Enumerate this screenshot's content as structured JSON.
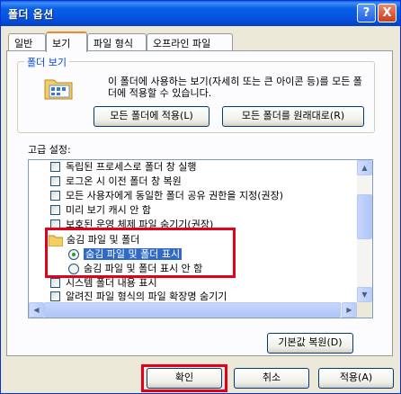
{
  "window": {
    "title": "폴더 옵션",
    "help_label": "?",
    "close_label": "X"
  },
  "tabs": [
    {
      "label": "일반",
      "active": false
    },
    {
      "label": "보기",
      "active": true
    },
    {
      "label": "파일 형식",
      "active": false
    },
    {
      "label": "오프라인 파일",
      "active": false
    }
  ],
  "folder_views": {
    "group_title": "폴더 보기",
    "description": "이 폴더에 사용하는 보기(자세히 또는 큰 아이콘 등)를 모든 폴더에 적용할 수 있습니다.",
    "apply_button": "모든 폴더에 적용(L)",
    "reset_button": "모든 폴더를 원래대로(R)",
    "icon": "folder-options-icon"
  },
  "advanced": {
    "label": "고급 설정:",
    "items": [
      {
        "type": "checkbox",
        "label": "독립된 프로세스로 폴더 창 실행",
        "checked": false
      },
      {
        "type": "checkbox",
        "label": "로그온 시 이전 폴더 창 복원",
        "checked": false
      },
      {
        "type": "checkbox",
        "label": "모든 사용자에게 동일한 폴더 공유 권한을 지정(권장)",
        "checked": false
      },
      {
        "type": "checkbox",
        "label": "미리 보기 캐시 안 함",
        "checked": false
      },
      {
        "type": "checkbox",
        "label": "보호된 운영 체제 파일 숨기기(권장)",
        "checked": false
      },
      {
        "type": "folder",
        "label": "숨김 파일 및 폴더"
      },
      {
        "type": "radio",
        "label": "숨김 파일 및 폴더 표시",
        "checked": true,
        "selected": true
      },
      {
        "type": "radio",
        "label": "숨김 파일 및 폴더 표시 안 함",
        "checked": false
      },
      {
        "type": "checkbox",
        "label": "시스템 폴더 내용 표시",
        "checked": false
      },
      {
        "type": "checkbox",
        "label": "알려진 파일 형식의 파일 확장명 숨기기",
        "checked": false
      }
    ],
    "restore_button": "기본값 복원(D)"
  },
  "footer": {
    "ok": "확인",
    "cancel": "취소",
    "apply": "적용(A)"
  },
  "colors": {
    "highlight": "#e3001b",
    "selection": "#316ac5",
    "titlebar": "#0a5fe6"
  }
}
